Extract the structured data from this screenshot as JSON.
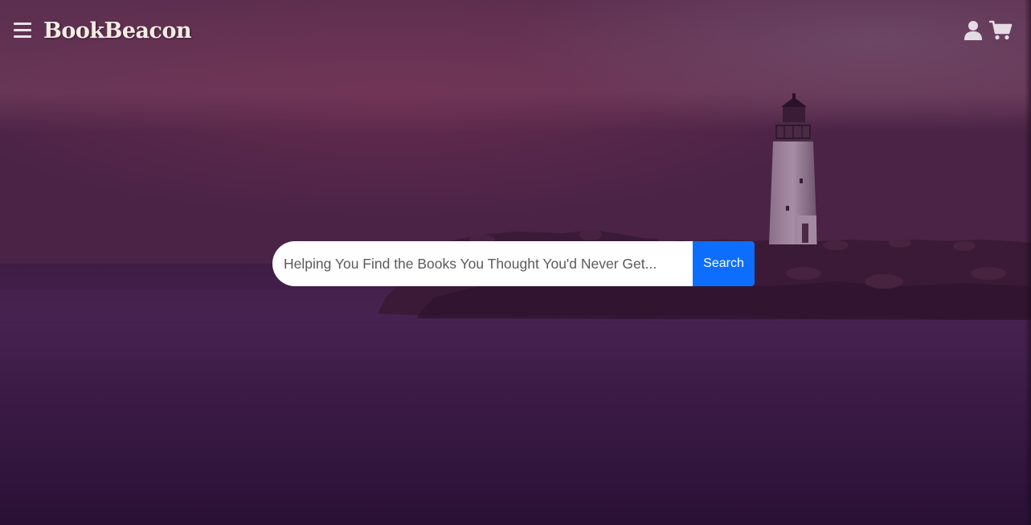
{
  "header": {
    "brand": "BookBeacon",
    "menu_icon": "hamburger-menu-icon",
    "user_icon": "user-account-icon",
    "cart_icon": "shopping-cart-icon"
  },
  "search": {
    "placeholder": "Helping You Find the Books You Thought You'd Never Get...",
    "button_label": "Search"
  },
  "theme": {
    "overlay": "#5a2a5c",
    "button": "#0d6efd",
    "brand_text": "#f4ece4"
  }
}
